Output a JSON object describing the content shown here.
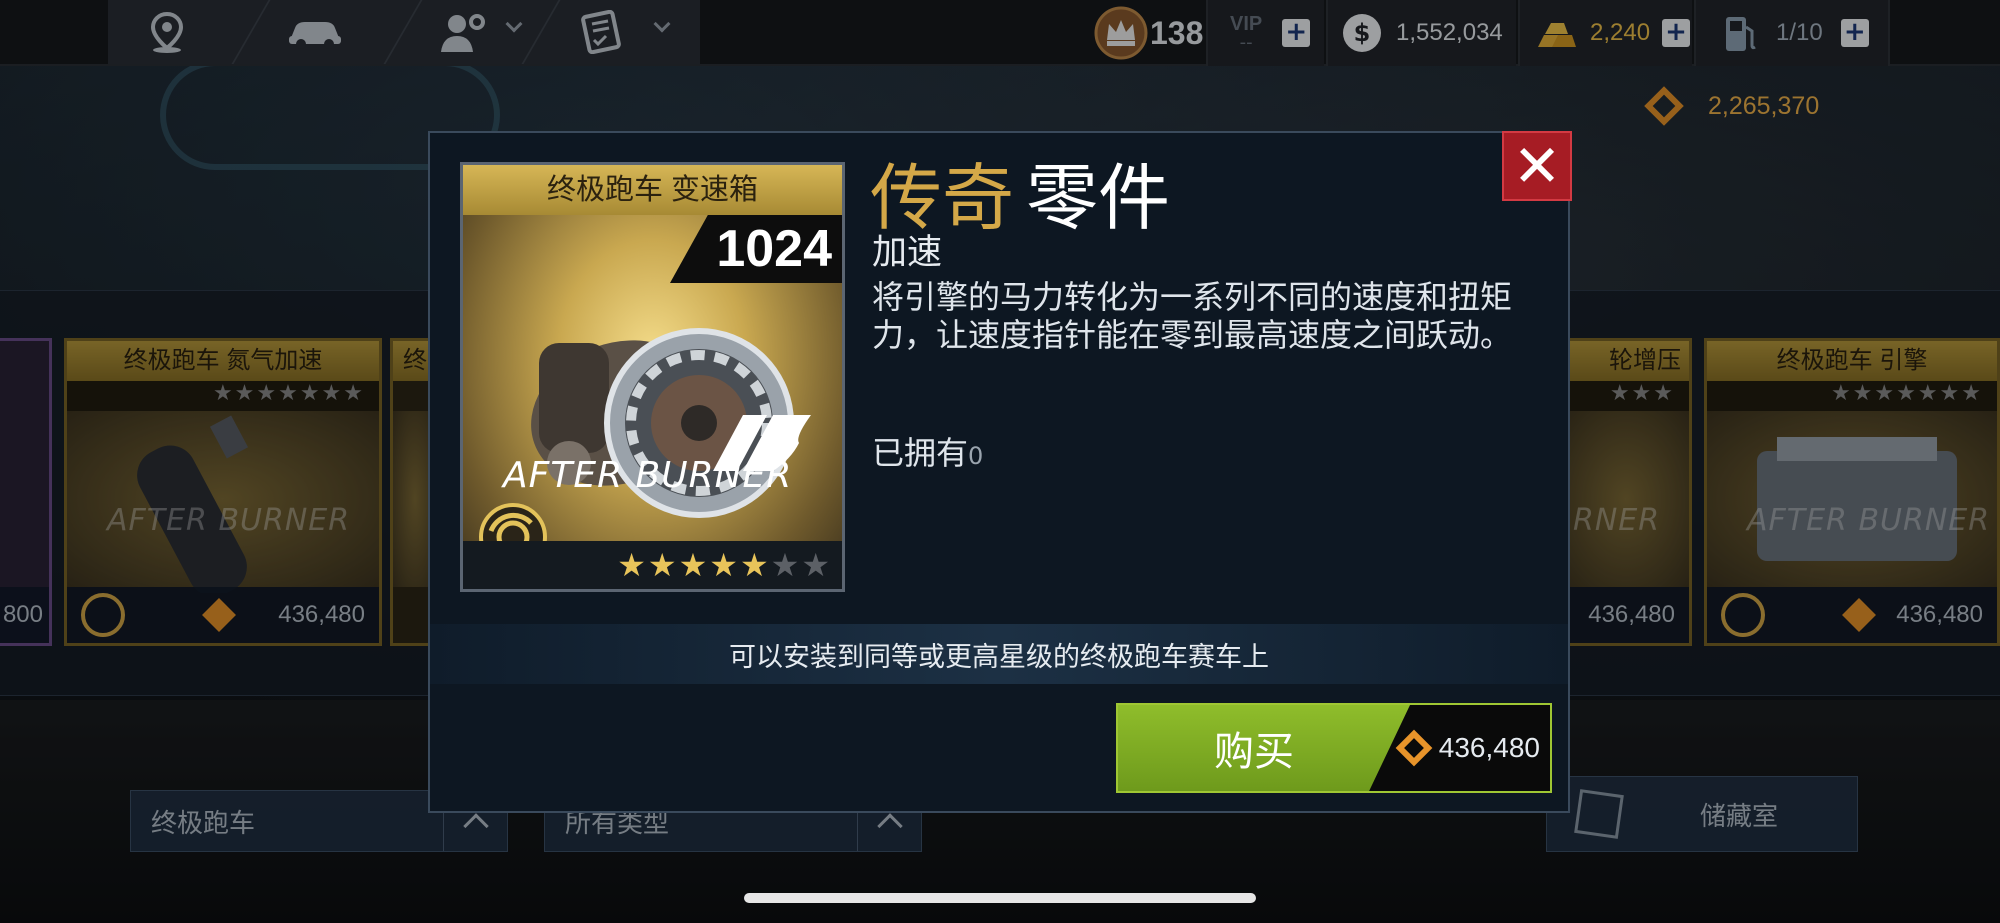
{
  "top_bar": {
    "crown_count": "138",
    "vip_label": "VIP",
    "vip_level": "--",
    "cash": "1,552,034",
    "gold": "2,240",
    "fuel": "1/10",
    "parts_currency": "2,265,370",
    "plus_symbol": "+",
    "nav_icons": [
      "map-pin-icon",
      "car-icon",
      "crew-settings-icon",
      "checklist-icon"
    ]
  },
  "background_cards": [
    {
      "title": "终极跑车 氮气加速",
      "price": "436,480",
      "logo": "AFTER BURNER"
    },
    {
      "title": "终",
      "price": "",
      "logo": ""
    },
    {
      "title": "轮增压",
      "price": "436,480",
      "logo": "RNER"
    },
    {
      "title": "终极跑车 引擎",
      "price": "436,480",
      "logo": "AFTER BURNER"
    }
  ],
  "left_partial_price": "800",
  "filters": {
    "class_filter": "终极跑车",
    "type_filter": "所有类型",
    "storage_label": "储藏室"
  },
  "modal": {
    "part_card": {
      "title": "终极跑车 变速箱",
      "rating": "1024",
      "logo_text": "AFTER BURNER",
      "stars_filled": 5,
      "stars_total": 7
    },
    "rarity_word": "传奇",
    "rarity_suffix": "零件",
    "stat": "加速",
    "description": "将引擎的马力转化为一系列不同的速度和扭矩力，让速度指针能在零到最高速度之间跃动。",
    "owned_label": "已拥有",
    "owned_count": "0",
    "compatibility": "可以安装到同等或更高星级的终极跑车赛车上",
    "buy_label": "购买",
    "price": "436,480",
    "close_symbol": "✕"
  },
  "colors": {
    "gold_accent": "#d4a848",
    "buy_green": "#7fae22",
    "close_red": "#a61c24",
    "currency_orange": "#e8942a"
  }
}
